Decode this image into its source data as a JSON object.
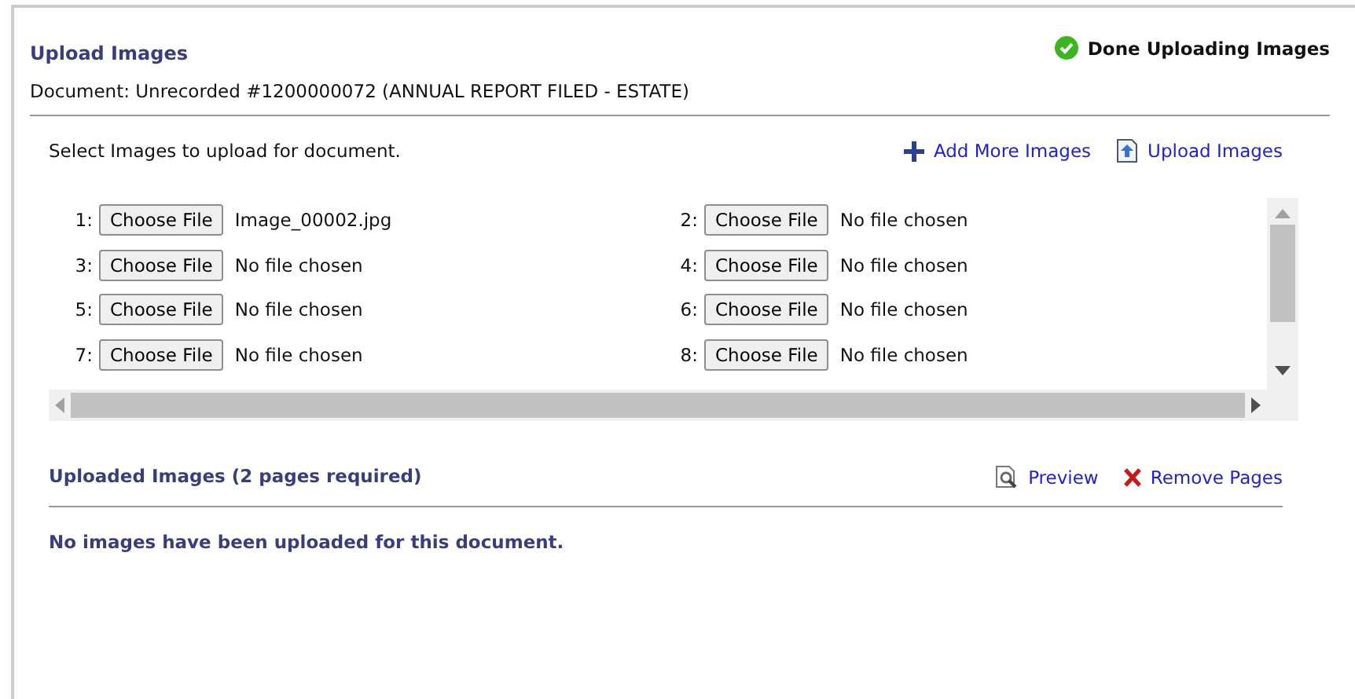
{
  "header": {
    "title": "Upload Images",
    "status": "Done Uploading Images",
    "document": "Document: Unrecorded #1200000072 (ANNUAL REPORT FILED - ESTATE)"
  },
  "select": {
    "instruction": "Select Images to upload for document.",
    "actions": [
      {
        "kind": "add",
        "label": "Add More Images"
      },
      {
        "kind": "upload",
        "label": "Upload Images"
      }
    ]
  },
  "files": [
    {
      "index": "1:",
      "button": "Choose File",
      "file": "Image_00002.jpg"
    },
    {
      "index": "2:",
      "button": "Choose File",
      "file": "No file chosen"
    },
    {
      "index": "3:",
      "button": "Choose File",
      "file": "No file chosen"
    },
    {
      "index": "4:",
      "button": "Choose File",
      "file": "No file chosen"
    },
    {
      "index": "5:",
      "button": "Choose File",
      "file": "No file chosen"
    },
    {
      "index": "6:",
      "button": "Choose File",
      "file": "No file chosen"
    },
    {
      "index": "7:",
      "button": "Choose File",
      "file": "No file chosen"
    },
    {
      "index": "8:",
      "button": "Choose File",
      "file": "No file chosen"
    }
  ],
  "uploaded": {
    "title": "Uploaded Images (2 pages required)",
    "actions": [
      {
        "kind": "preview",
        "label": "Preview"
      },
      {
        "kind": "remove",
        "label": "Remove Pages"
      }
    ],
    "message": "No images have been uploaded for this document."
  }
}
